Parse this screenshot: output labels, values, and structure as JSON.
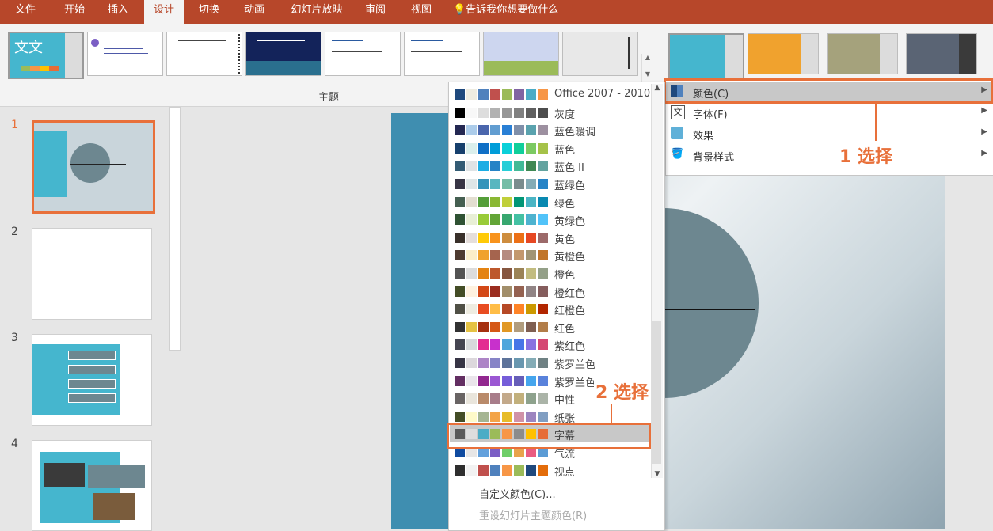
{
  "ribbon_tabs": [
    "文件",
    "开始",
    "插入",
    "设计",
    "切换",
    "动画",
    "幻灯片放映",
    "审阅",
    "视图"
  ],
  "tell_me": "告诉我你想要做什么",
  "themes_group_label": "主题",
  "first_theme_thumb_text": "文文",
  "slide_numbers": [
    "1",
    "2",
    "3",
    "4"
  ],
  "variants_menu": [
    {
      "label": "颜色(C)"
    },
    {
      "label": "字体(F)"
    },
    {
      "label": "效果"
    },
    {
      "label": "背景样式"
    }
  ],
  "callout1": "1 选择",
  "callout2": "2 选择",
  "color_schemes": [
    {
      "name": "Office 2007 - 2010",
      "colors": [
        "#1f497d",
        "#eeece1",
        "#4f81bd",
        "#c0504d",
        "#9bbb59",
        "#8064a2",
        "#4bacc6",
        "#f79646"
      ]
    },
    {
      "name": "灰度",
      "colors": [
        "#000000",
        "#f8f8f8",
        "#dddddd",
        "#b2b2b2",
        "#969696",
        "#808080",
        "#5f5f5f",
        "#4d4d4d"
      ]
    },
    {
      "name": "蓝色暖调",
      "colors": [
        "#242852",
        "#acccea",
        "#4a66ac",
        "#629dd1",
        "#297fd5",
        "#7f8fa9",
        "#5aa2ae",
        "#9d90a0"
      ]
    },
    {
      "name": "蓝色",
      "colors": [
        "#17406d",
        "#dbefec",
        "#0f6fc6",
        "#009dd9",
        "#0bd0d9",
        "#10cf9b",
        "#7cca62",
        "#a5c249"
      ]
    },
    {
      "name": "蓝色 II",
      "colors": [
        "#335b74",
        "#dfe3e5",
        "#1cade4",
        "#2683c6",
        "#27ced7",
        "#42ba97",
        "#3e8853",
        "#62a39f"
      ]
    },
    {
      "name": "蓝绿色",
      "colors": [
        "#373545",
        "#dee6e7",
        "#3494ba",
        "#58b6c0",
        "#75bda7",
        "#7a8c8e",
        "#84acb6",
        "#2683c6"
      ]
    },
    {
      "name": "绿色",
      "colors": [
        "#455f51",
        "#e3ded1",
        "#549e39",
        "#8ab833",
        "#c0cf3a",
        "#029676",
        "#4ab5c4",
        "#0989b1"
      ]
    },
    {
      "name": "黄绿色",
      "colors": [
        "#2f5233",
        "#e8efd6",
        "#99cb38",
        "#63a537",
        "#37a76f",
        "#44c1a3",
        "#4eb3cf",
        "#51c3f9"
      ]
    },
    {
      "name": "黄色",
      "colors": [
        "#39302a",
        "#e5dedb",
        "#ffca08",
        "#f8931d",
        "#ce8d3e",
        "#ec7016",
        "#e64823",
        "#9c6a6a"
      ]
    },
    {
      "name": "黄橙色",
      "colors": [
        "#4e3b30",
        "#fbeec9",
        "#f0a22e",
        "#a5644e",
        "#b58b80",
        "#c3986d",
        "#a19574",
        "#c17529"
      ]
    },
    {
      "name": "橙色",
      "colors": [
        "#535353",
        "#dcdcdc",
        "#e48312",
        "#bd582c",
        "#865640",
        "#9b8357",
        "#c2bc80",
        "#94a088"
      ]
    },
    {
      "name": "橙红色",
      "colors": [
        "#444d26",
        "#fef2e0",
        "#d34817",
        "#9b2d1f",
        "#a28e6a",
        "#956251",
        "#918485",
        "#855d5d"
      ]
    },
    {
      "name": "红橙色",
      "colors": [
        "#505046",
        "#eeece1",
        "#e84c22",
        "#ffbd47",
        "#b64926",
        "#ff8427",
        "#cc9900",
        "#b22600"
      ]
    },
    {
      "name": "红色",
      "colors": [
        "#323232",
        "#e5c243",
        "#a5300f",
        "#d55816",
        "#e19825",
        "#b19c7d",
        "#7f5f52",
        "#b27d49"
      ]
    },
    {
      "name": "紫红色",
      "colors": [
        "#454551",
        "#d8d9dc",
        "#e32d91",
        "#c830cc",
        "#4ea6dc",
        "#4775e7",
        "#8971e1",
        "#d54773"
      ]
    },
    {
      "name": "紫罗兰色",
      "colors": [
        "#373545",
        "#dcd8dc",
        "#ad84c6",
        "#8784c7",
        "#5d739a",
        "#6997af",
        "#84acb6",
        "#6f8183"
      ]
    },
    {
      "name": "紫罗兰色 II",
      "colors": [
        "#632e62",
        "#eae5eb",
        "#92278f",
        "#9b57d3",
        "#755dd9",
        "#665eb8",
        "#45a5ed",
        "#5982db"
      ]
    },
    {
      "name": "中性",
      "colors": [
        "#696464",
        "#e9e5dc",
        "#b98a6a",
        "#a87d8a",
        "#c3a98a",
        "#c2b07c",
        "#8ea28d",
        "#abb4a8"
      ]
    },
    {
      "name": "纸张",
      "colors": [
        "#444d26",
        "#fefac9",
        "#a5b592",
        "#f3a447",
        "#e7bc29",
        "#d092a7",
        "#9c85c0",
        "#809ec2"
      ]
    },
    {
      "name": "字幕",
      "colors": [
        "#595959",
        "#dddddd",
        "#4bacc6",
        "#9bbb59",
        "#f79646",
        "#8c8c8c",
        "#ffc000",
        "#e66c37"
      ]
    },
    {
      "name": "气流",
      "colors": [
        "#0f4ba0",
        "#e7e6e6",
        "#62a0dc",
        "#7b5ec4",
        "#6fce68",
        "#e8a34b",
        "#e95b81",
        "#5b9bd5"
      ]
    },
    {
      "name": "视点",
      "colors": [
        "#2e2e2e",
        "#f2f2f2",
        "#c0504d",
        "#4f81bd",
        "#f79646",
        "#9bbb59",
        "#1f497d",
        "#e36c0a"
      ]
    }
  ],
  "footer_items": [
    "自定义颜色(C)...",
    "重设幻灯片主题颜色(R)"
  ],
  "colors": {
    "ribbon_red": "#b7472a",
    "highlight": "#e8703a",
    "teal": "#45b6ce",
    "slate": "#6d8790"
  }
}
